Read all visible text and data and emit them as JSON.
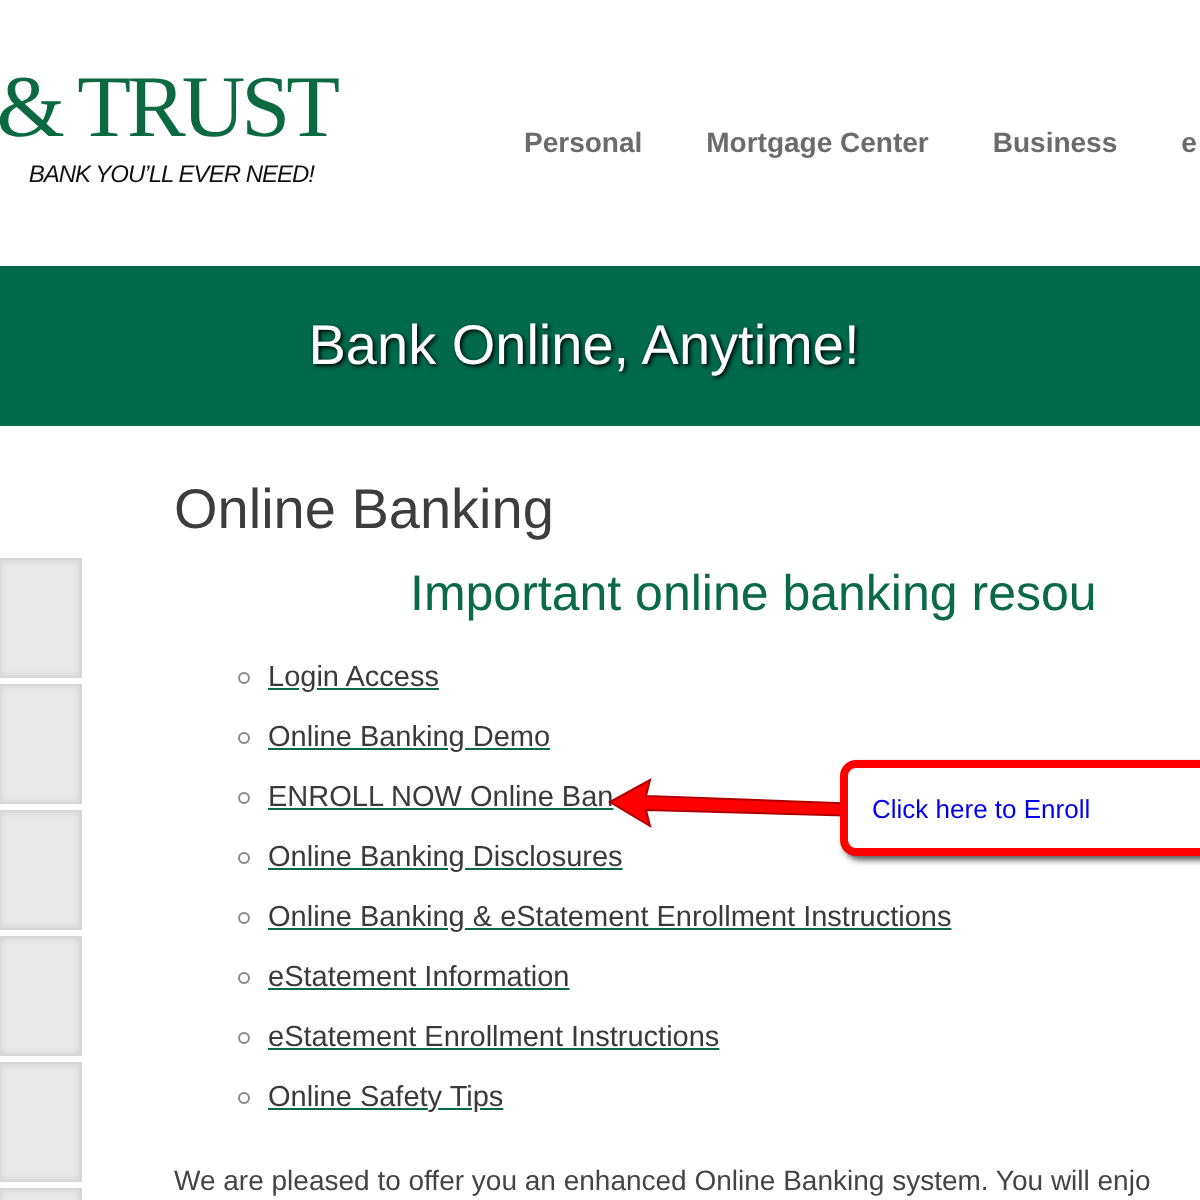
{
  "logo": {
    "name": "& TRUST",
    "tagline": "BANK YOU’LL EVER NEED!"
  },
  "nav": [
    {
      "label": "Personal"
    },
    {
      "label": "Mortgage Center"
    },
    {
      "label": "Business"
    },
    {
      "label": "e"
    }
  ],
  "banner": {
    "title": "Bank Online, Anytime!"
  },
  "content": {
    "heading": "Online Banking",
    "subheading": "Important online banking resou",
    "links": [
      {
        "label": "Login Access"
      },
      {
        "label": "Online Banking Demo"
      },
      {
        "label": "ENROLL NOW Online Ban"
      },
      {
        "label": "Online Banking Disclosures"
      },
      {
        "label": "Online Banking & eStatement Enrollment Instructions"
      },
      {
        "label": "eStatement Information"
      },
      {
        "label": "eStatement Enrollment Instructions"
      },
      {
        "label": "Online Safety Tips"
      }
    ],
    "paragraph": "We are pleased to offer you an enhanced Online Banking system. You will enjo"
  },
  "callout": {
    "text": "Click here to Enroll"
  }
}
